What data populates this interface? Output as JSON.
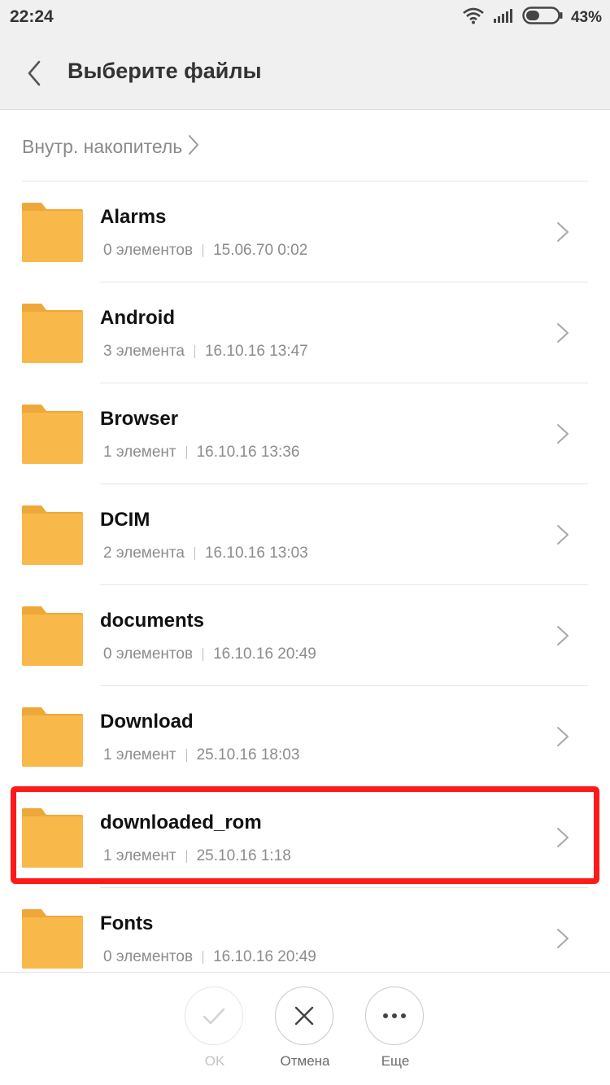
{
  "status_bar": {
    "time": "22:24",
    "battery_percent": "43%",
    "battery_level": 0.43
  },
  "header": {
    "title": "Выберите файлы"
  },
  "breadcrumb": {
    "label": "Внутр. накопитель"
  },
  "colors": {
    "folder": "#f9b94a",
    "folder_tab": "#eea83a",
    "highlight": "#ff1a1a"
  },
  "folders": [
    {
      "name": "Alarms",
      "count": "0 элементов",
      "date": "15.06.70 0:02"
    },
    {
      "name": "Android",
      "count": "3 элемента",
      "date": "16.10.16 13:47"
    },
    {
      "name": "Browser",
      "count": "1 элемент",
      "date": "16.10.16 13:36"
    },
    {
      "name": "DCIM",
      "count": "2 элемента",
      "date": "16.10.16 13:03"
    },
    {
      "name": "documents",
      "count": "0 элементов",
      "date": "16.10.16 20:49"
    },
    {
      "name": "Download",
      "count": "1 элемент",
      "date": "25.10.16 18:03"
    },
    {
      "name": "downloaded_rom",
      "count": "1 элемент",
      "date": "25.10.16 1:18",
      "highlighted": true
    },
    {
      "name": "Fonts",
      "count": "0 элементов",
      "date": "16.10.16 20:49"
    }
  ],
  "actions": {
    "ok": {
      "label": "OK",
      "icon": "check-icon",
      "enabled": false
    },
    "cancel": {
      "label": "Отмена",
      "icon": "close-icon"
    },
    "more": {
      "label": "Еще",
      "icon": "more-dots-icon"
    }
  }
}
